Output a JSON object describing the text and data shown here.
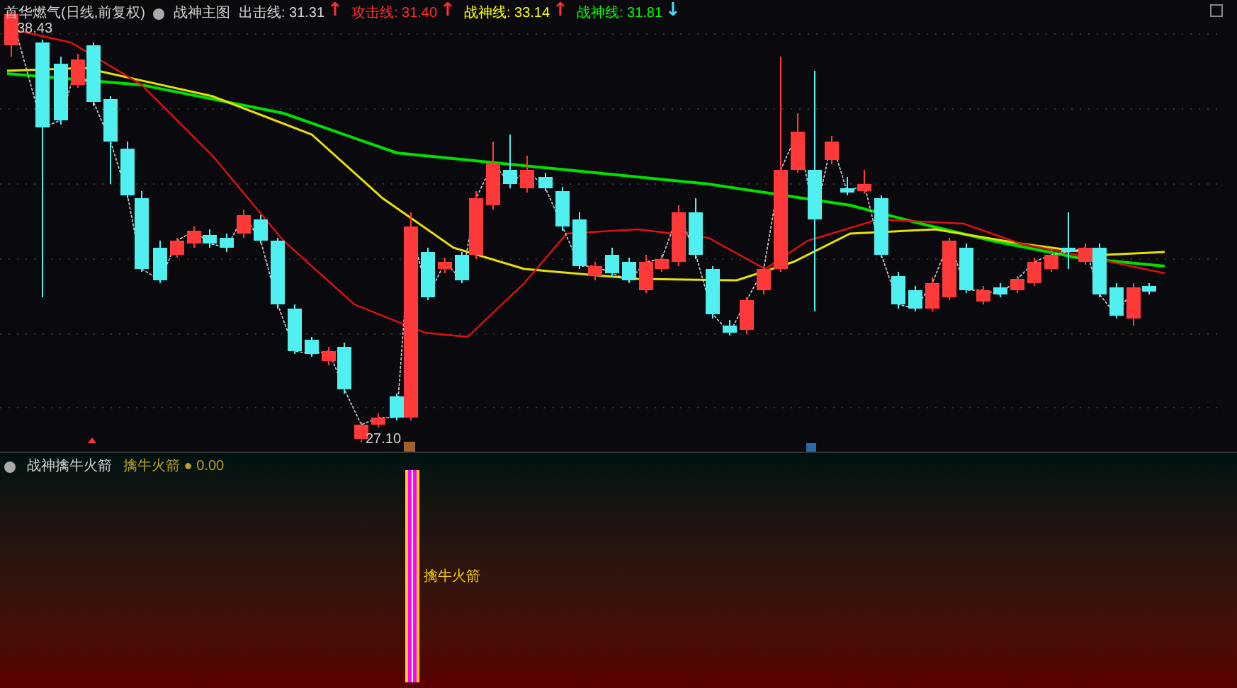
{
  "header": {
    "title": "首华燃气(日线,前复权)",
    "indicator": "战神主图",
    "lines": [
      {
        "label": "出击线:",
        "value": "31.31",
        "arrow": {
          "text": "↑",
          "color": "#ff3030"
        },
        "color": "#d8d8d8"
      },
      {
        "label": "攻击线:",
        "value": "31.40",
        "arrow": {
          "text": "↑",
          "color": "#ff3030"
        },
        "color": "#ff3030"
      },
      {
        "label": "战神线:",
        "value": "33.14",
        "arrow": {
          "text": "↑",
          "color": "#ff3030"
        },
        "color": "#ffff00"
      },
      {
        "label": "战神线:",
        "value": "31.81",
        "arrow": {
          "text": "↓",
          "color": "#40e0ff"
        },
        "color": "#00ff00"
      }
    ]
  },
  "price_labels": {
    "high": "38.43",
    "low": "27.10"
  },
  "lower_panel": {
    "title": "战神擒牛火箭",
    "value_label": "擒牛火箭",
    "marker": "●",
    "value": "0.00",
    "signal_label": "擒牛火箭"
  }
}
